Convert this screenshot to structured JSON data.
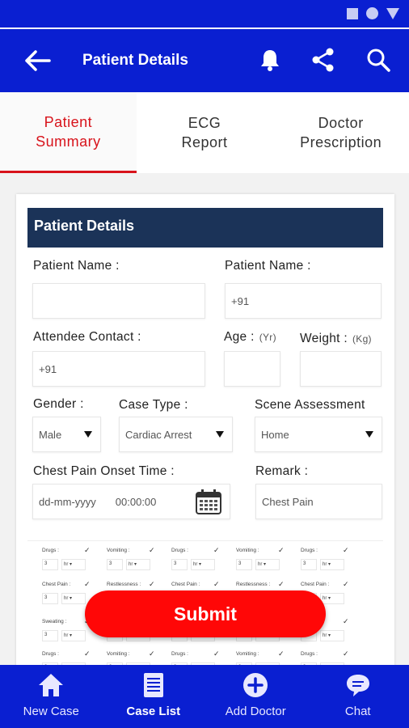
{
  "app_bar": {
    "title": "Patient Details"
  },
  "tabs": [
    {
      "line1": "Patient",
      "line2": "Summary"
    },
    {
      "line1": "ECG",
      "line2": "Report"
    },
    {
      "line1": "Doctor",
      "line2": "Prescription"
    }
  ],
  "form": {
    "section_title": "Patient Details",
    "patient_name_label_1": "Patient Name :",
    "patient_name_label_2": "Patient Name :",
    "patient_name_value": "",
    "patient_phone_value": "+91",
    "attendee_contact_label": "Attendee Contact :",
    "attendee_contact_value": "+91",
    "age_label": "Age :",
    "age_unit": "(Yr)",
    "age_value": "",
    "weight_label": "Weight :",
    "weight_unit": "(Kg)",
    "weight_value": "",
    "gender_label": "Gender :",
    "gender_value": "Male",
    "case_type_label": "Case Type :",
    "case_type_value": "Cardiac Arrest",
    "scene_assessment_label": "Scene Assessment",
    "scene_assessment_value": "Home",
    "chest_pain_label": "Chest Pain Onset Time :",
    "date_placeholder": "dd-mm-yyyy",
    "time_value": "00:00:00",
    "remark_label": "Remark :",
    "remark_value": "Chest Pain"
  },
  "symptom_grid": {
    "rows": [
      [
        "Drugs :",
        "Vomiting :",
        "Drugs :",
        "Vomiting :",
        "Drugs :"
      ],
      [
        "Chest Pain :",
        "Restlessness :",
        "Chest Pain :",
        "Restlessness :",
        "Chest Pain :"
      ],
      [
        "Sweating :",
        "",
        "",
        "",
        ""
      ],
      [
        "Drugs :",
        "Vomiting :",
        "Drugs :",
        "Vomiting :",
        "Drugs :"
      ]
    ],
    "count": "3",
    "unit": "hr"
  },
  "submit_label": "Submit",
  "bottom_nav": [
    {
      "label": "New Case",
      "icon": "home-icon"
    },
    {
      "label": "Case List",
      "icon": "list-icon"
    },
    {
      "label": "Add Doctor",
      "icon": "add-circle-icon"
    },
    {
      "label": "Chat",
      "icon": "chat-icon"
    }
  ],
  "colors": {
    "primary": "#0a1fd1",
    "accent": "#ff0707",
    "header": "#1b3358",
    "active_tab": "#d8131b"
  }
}
